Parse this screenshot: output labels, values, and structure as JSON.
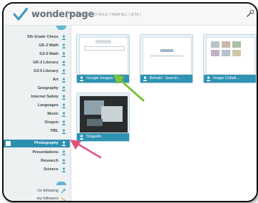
{
  "header": {
    "brand": "wonderpage",
    "tagline": "ONE PAGE TO RULE THEM ALL | SITE |",
    "logo_icon": "wonderpage-logo-icon",
    "tools_icon": "wrench-icon"
  },
  "sidebar": {
    "items": [
      {
        "label": "5th Grade Chess"
      },
      {
        "label": "GK-2 Math"
      },
      {
        "label": "G3-5 Math"
      },
      {
        "label": "GK-2 Literacy"
      },
      {
        "label": "G3-5 Literacy"
      },
      {
        "label": "Art"
      },
      {
        "label": "Geography"
      },
      {
        "label": "Internet Safety"
      },
      {
        "label": "Languages"
      },
      {
        "label": "Music"
      },
      {
        "label": "Oregon"
      },
      {
        "label": "PBL"
      },
      {
        "label": "Photography",
        "active": true
      },
      {
        "label": "Presentations"
      },
      {
        "label": "Research"
      },
      {
        "label": "Science"
      }
    ],
    "footer": [
      {
        "label": "i'm following",
        "icon": "rss-icon"
      },
      {
        "label": "my followers",
        "icon": "rss-icon"
      }
    ]
  },
  "tiles": [
    {
      "label": "Google Images"
    },
    {
      "label": "Behold : Search..."
    },
    {
      "label": "Image Cribell..."
    },
    {
      "label": "Shapefix"
    }
  ],
  "colors": {
    "accent": "#2f93b3",
    "active_item": "#2d8fb0",
    "green_arrow": "#7cc53a",
    "pink_arrow": "#e0507a"
  }
}
